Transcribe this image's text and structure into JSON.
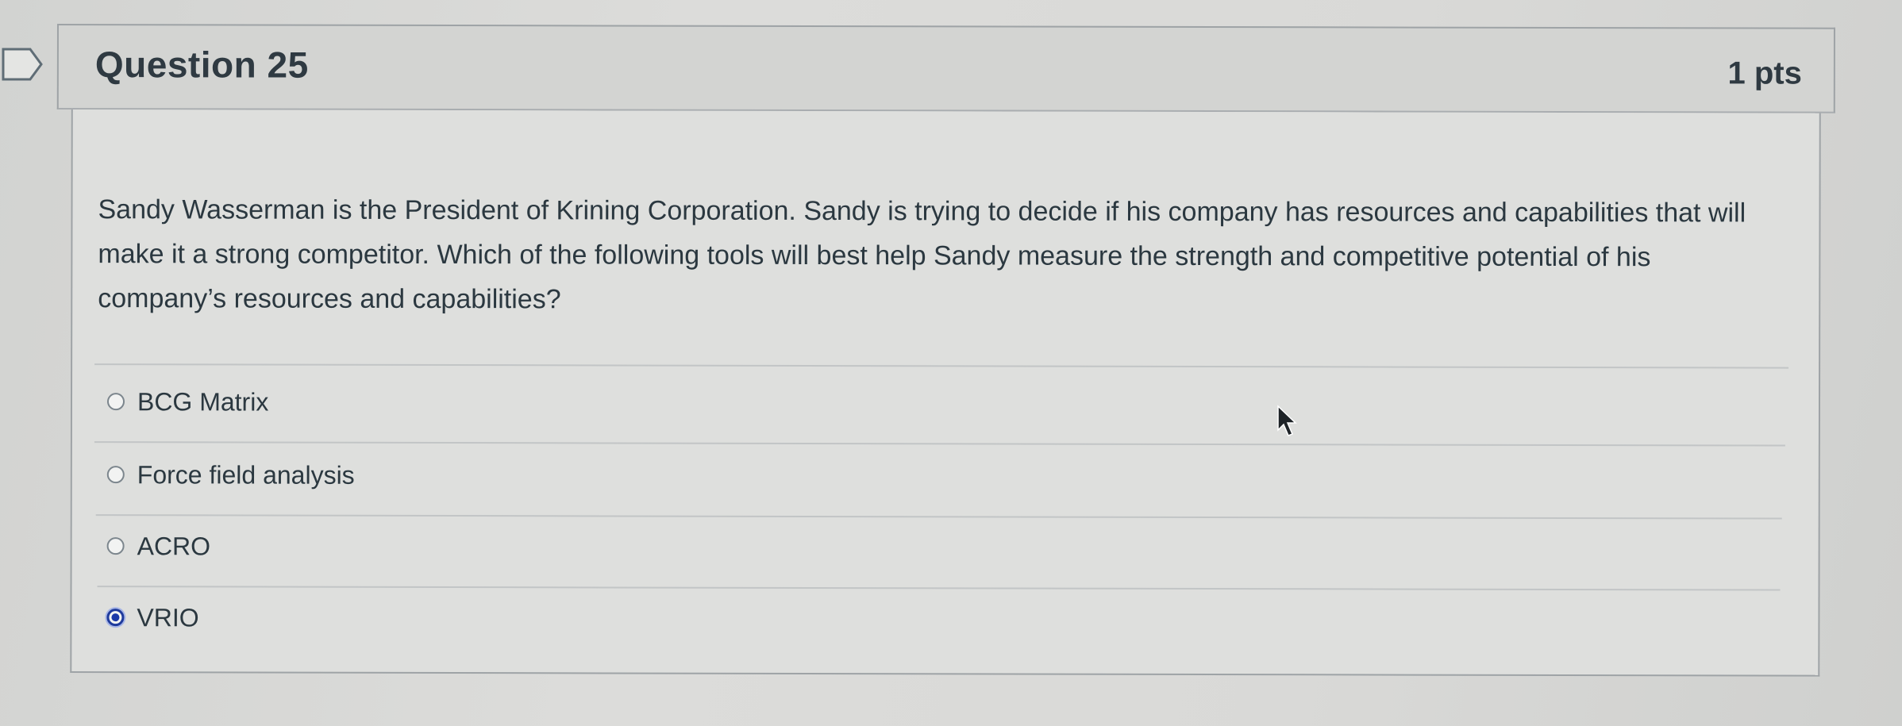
{
  "question": {
    "title": "Question 25",
    "points": "1 pts",
    "text": "Sandy Wasserman is the President of Krining Corporation. Sandy is trying to decide if his company has resources and capabilities that will make it a strong competitor. Which of the following tools will best help Sandy measure the strength and competitive potential of his company’s resources and capabilities?"
  },
  "answers": [
    {
      "label": "BCG Matrix",
      "selected": false
    },
    {
      "label": "Force field analysis",
      "selected": false
    },
    {
      "label": "ACRO",
      "selected": false
    },
    {
      "label": "VRIO",
      "selected": true
    }
  ],
  "colors": {
    "header_bg": "#d3d4d2",
    "body_bg": "#dedfdd",
    "text": "#2b3840",
    "selected_radio": "#1c3aa8"
  },
  "icons": [
    "flag-icon",
    "cursor-icon"
  ]
}
